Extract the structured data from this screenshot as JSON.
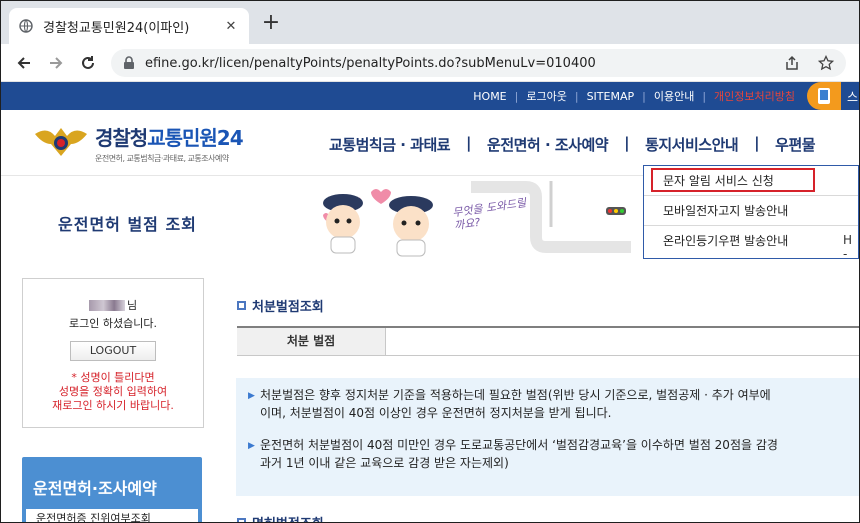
{
  "browser": {
    "tab_title": "경찰청교통민원24(이파인)",
    "new_tab": "+",
    "url": "efine.go.kr/licen/penaltyPoints/penaltyPoints.do?subMenuLv=010400"
  },
  "topnav": {
    "home": "HOME",
    "logout": "로그아웃",
    "sitemap": "SITEMAP",
    "guide": "이용안내",
    "red_link": "개인정보처리방침",
    "partial": "스"
  },
  "logo": {
    "title_a": "경찰청",
    "title_b": "교통민원24",
    "subtitle": "운전면허, 교통범칙금·과태료, 교통조사예약"
  },
  "gnb": {
    "items": [
      "교통범칙금 · 과태료",
      "운전면허 · 조사예약",
      "통지서비스안내",
      "우편물"
    ],
    "separator": "|"
  },
  "dropdown": {
    "items": [
      "문자 알림 서비스 신청",
      "모바일전자고지 발송안내",
      "온라인등기우편 발송안내"
    ],
    "overflow": "H -"
  },
  "banner": {
    "title": "운전면허 벌점 조회",
    "speech": "무엇을 도와드릴까요?"
  },
  "login": {
    "suffix": "님",
    "message": "로그인 하셨습니다.",
    "logout_button": "LOGOUT",
    "warning_lines": [
      "* 성명이 틀리다면",
      "성명을 정확히 입력하여",
      "재로그인 하시기 바랍니다."
    ]
  },
  "sidemenu": {
    "title": "운전면허·조사예약",
    "sub_item": "운전면허증 진위여부조회"
  },
  "content": {
    "section_title": "처분벌점조회",
    "table_header": "처분 벌점",
    "info": [
      [
        "처분벌점은 향후 정지처분 기준을 적용하는데 필요한 벌점(위반 당시 기준으로, 벌점공제 · 추가 여부에",
        "이며, 처분벌점이 40점 이상인 경우 운전면허 정지처분을 받게 됩니다."
      ],
      [
        "운전면허 처분벌점이 40점 미만인 경우 도로교통공단에서 ‘벌점감경교육’을 이수하면 벌점 20점을 감경",
        "과거 1년 이내 같은 교육으로 감경 받은 자는제외)"
      ]
    ],
    "section_title_2": "면허벌점조회"
  },
  "colors": {
    "navy": "#1f4b93",
    "accent_red": "#d6222a",
    "info_bg": "#e9f3fb",
    "side_blue": "#4c8fd2"
  }
}
